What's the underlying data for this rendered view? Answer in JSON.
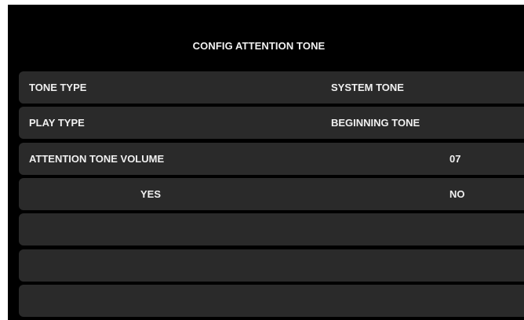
{
  "title": "CONFIG ATTENTION TONE",
  "rows": [
    {
      "label": "TONE TYPE",
      "value": "SYSTEM TONE"
    },
    {
      "label": "PLAY TYPE",
      "value": "BEGINNING TONE"
    },
    {
      "label": "ATTENTION TONE VOLUME",
      "value": "07"
    }
  ],
  "buttons": {
    "yes": "YES",
    "no": "NO"
  },
  "colors": {
    "background": "#000000",
    "row": "#2a2a2a",
    "text": "#f0f0f0"
  }
}
